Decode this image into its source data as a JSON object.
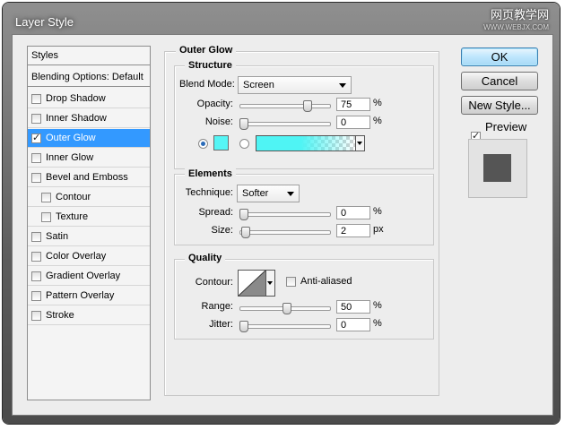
{
  "window": {
    "title": "Layer Style"
  },
  "watermark": {
    "text": "网页教学网",
    "url": "WWW.WEBJX.COM"
  },
  "styles_list": {
    "header": "Styles",
    "blending": "Blending Options: Default",
    "items": [
      {
        "label": "Drop Shadow",
        "checked": false
      },
      {
        "label": "Inner Shadow",
        "checked": false
      },
      {
        "label": "Outer Glow",
        "checked": true,
        "selected": true
      },
      {
        "label": "Inner Glow",
        "checked": false
      },
      {
        "label": "Bevel and Emboss",
        "checked": false
      },
      {
        "label": "Contour",
        "checked": false,
        "indent": true
      },
      {
        "label": "Texture",
        "checked": false,
        "indent": true
      },
      {
        "label": "Satin",
        "checked": false
      },
      {
        "label": "Color Overlay",
        "checked": false
      },
      {
        "label": "Gradient Overlay",
        "checked": false
      },
      {
        "label": "Pattern Overlay",
        "checked": false
      },
      {
        "label": "Stroke",
        "checked": false
      }
    ]
  },
  "outer_glow": {
    "title": "Outer Glow",
    "structure": {
      "title": "Structure",
      "blend_mode_label": "Blend Mode:",
      "blend_mode_value": "Screen",
      "opacity_label": "Opacity:",
      "opacity_value": "75",
      "opacity_unit": "%",
      "opacity_level": 0.75,
      "noise_label": "Noise:",
      "noise_value": "0",
      "noise_unit": "%",
      "glow_color": "#55f5f5",
      "gradient_color": "#4ff4f4",
      "color_radio_selected": true
    },
    "elements": {
      "title": "Elements",
      "technique_label": "Technique:",
      "technique_value": "Softer",
      "spread_label": "Spread:",
      "spread_value": "0",
      "spread_unit": "%",
      "size_label": "Size:",
      "size_value": "2",
      "size_unit": "px"
    },
    "quality": {
      "title": "Quality",
      "contour_label": "Contour:",
      "anti_aliased_label": "Anti-aliased",
      "anti_aliased": false,
      "range_label": "Range:",
      "range_value": "50",
      "range_unit": "%",
      "jitter_label": "Jitter:",
      "jitter_value": "0",
      "jitter_unit": "%"
    }
  },
  "buttons": {
    "ok": "OK",
    "cancel": "Cancel",
    "new_style": "New Style...",
    "preview_label": "Preview",
    "preview_checked": true
  },
  "colors": {
    "selection": "#3399ff",
    "preview_swatch": "#555555"
  }
}
